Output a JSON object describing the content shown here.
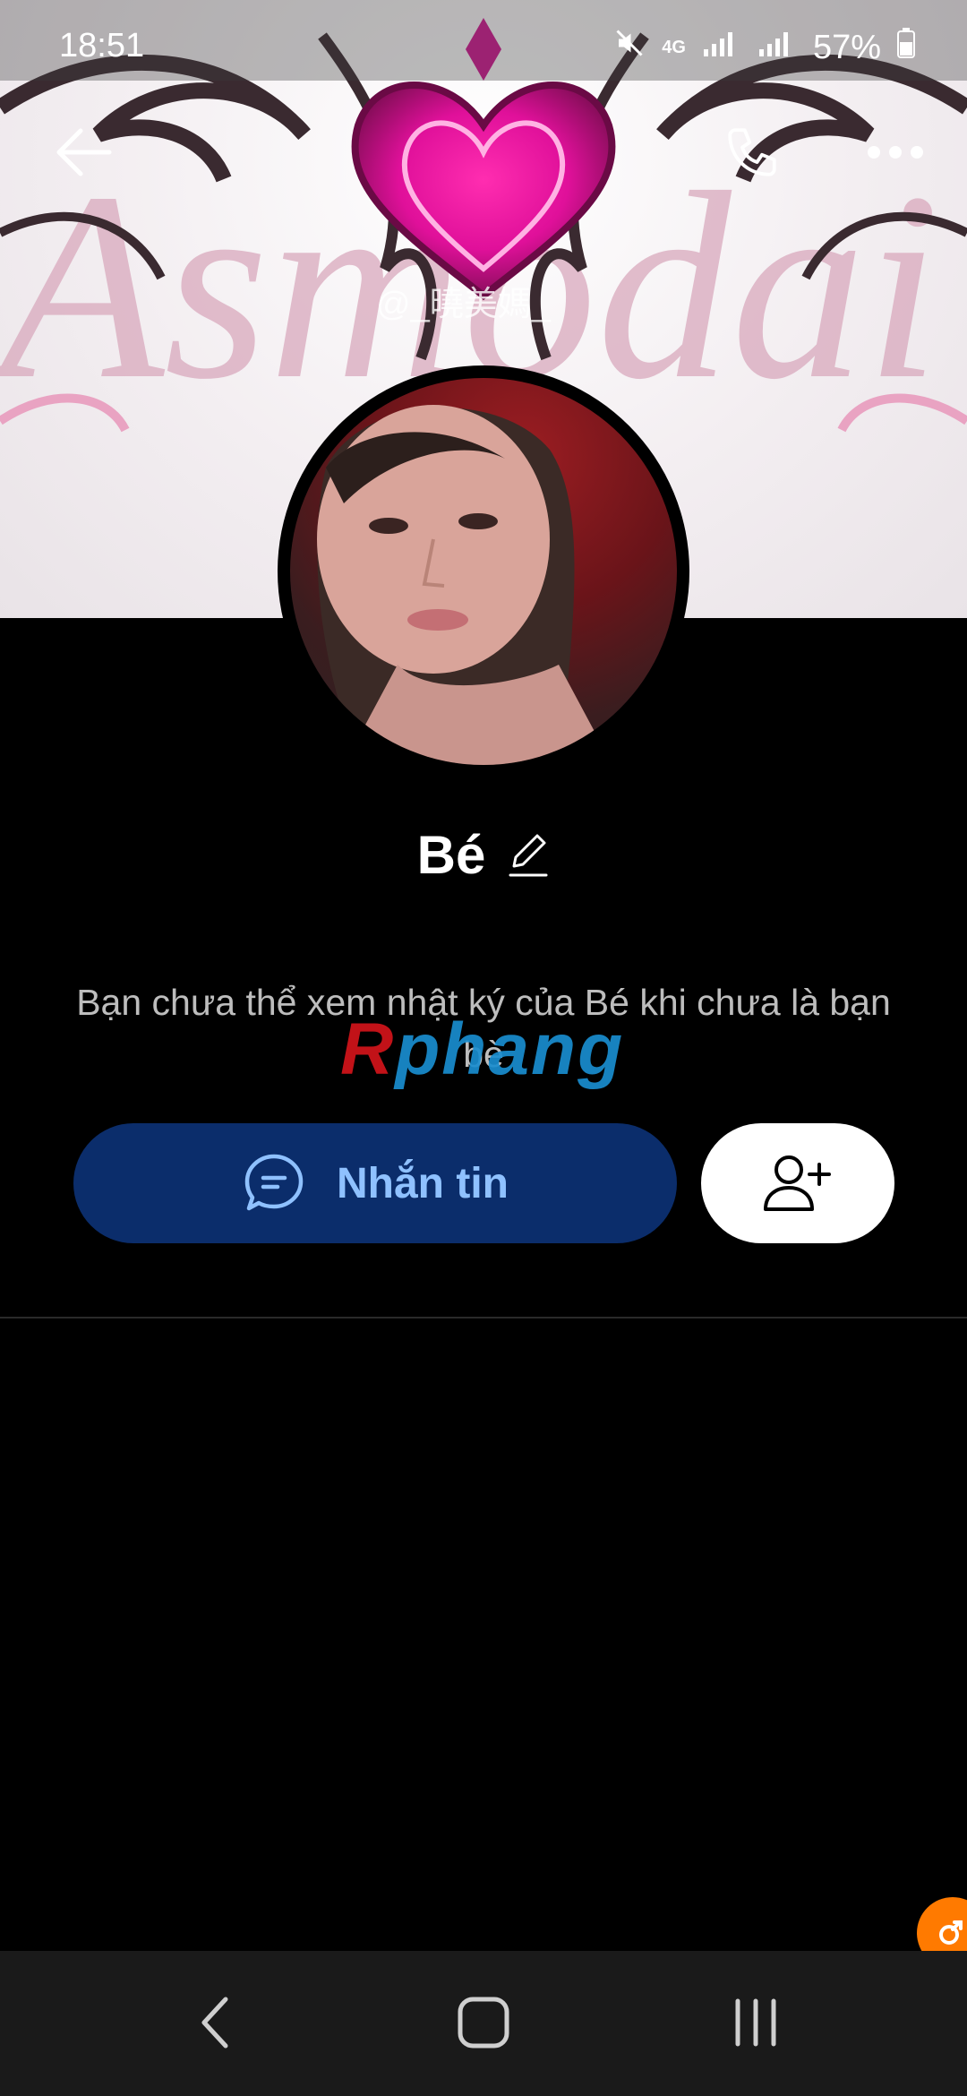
{
  "status_bar": {
    "time": "18:51",
    "network_label": "4G",
    "battery": "57%"
  },
  "cover": {
    "watermark_text": "@_曉美媽_",
    "background_word": "Asmodai"
  },
  "header": {
    "back_icon": "arrow-left-icon",
    "call_icon": "phone-icon",
    "more_icon": "more-horizontal-icon"
  },
  "profile": {
    "name": "Bé",
    "edit_icon": "pencil-icon",
    "notice": "Bạn chưa thể xem nhật ký của Bé khi chưa là bạn bè"
  },
  "watermark": {
    "first_letter": "R",
    "rest": "phang"
  },
  "actions": {
    "message_label": "Nhắn tin",
    "message_icon": "chat-bubble-icon",
    "add_friend_icon": "add-user-icon"
  },
  "colors": {
    "message_button_bg": "#0b2d6b",
    "message_button_text": "#8fc1ff",
    "accent_orange": "#ff7a00"
  },
  "nav": {
    "back_icon": "nav-back-icon",
    "home_icon": "nav-home-icon",
    "recents_icon": "nav-recents-icon"
  }
}
